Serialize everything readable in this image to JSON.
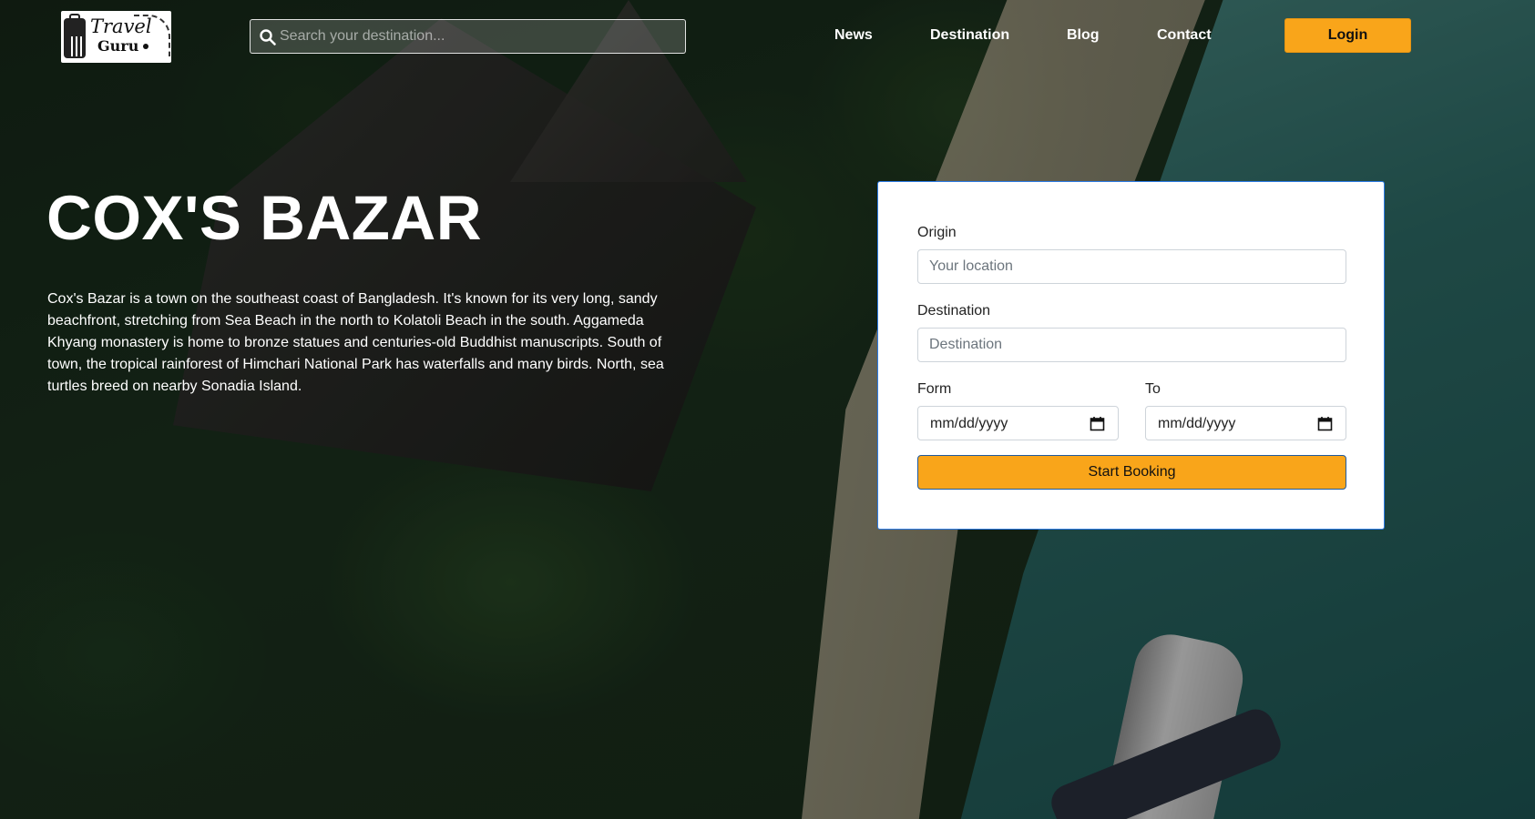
{
  "brand": {
    "logo_line1": "Travel",
    "logo_line2": "Guru"
  },
  "search": {
    "placeholder": "Search your destination..."
  },
  "nav": {
    "items": [
      "News",
      "Destination",
      "Blog",
      "Contact"
    ]
  },
  "login": {
    "label": "Login"
  },
  "hero": {
    "title": "COX'S BAZAR",
    "description": "Cox's Bazar is a town on the southeast coast of Bangladesh. It's known for its very long, sandy beachfront, stretching from Sea Beach in the north to Kolatoli Beach in the south. Aggameda Khyang monastery is home to bronze statues and centuries-old Buddhist manuscripts. South of town, the tropical rainforest of Himchari National Park has waterfalls and many birds. North, sea turtles breed on nearby Sonadia Island."
  },
  "booking": {
    "origin": {
      "label": "Origin",
      "placeholder": "Your location"
    },
    "destination": {
      "label": "Destination",
      "placeholder": "Destination"
    },
    "from": {
      "label": "Form",
      "value": "mm/dd/yyyy"
    },
    "to": {
      "label": "To",
      "value": "mm/dd/yyyy"
    },
    "submit": "Start Booking"
  },
  "colors": {
    "accent": "#f9a51a",
    "card_border": "#2c7be5",
    "icons": [
      "search-icon",
      "calendar-icon",
      "luggage-icon"
    ]
  }
}
